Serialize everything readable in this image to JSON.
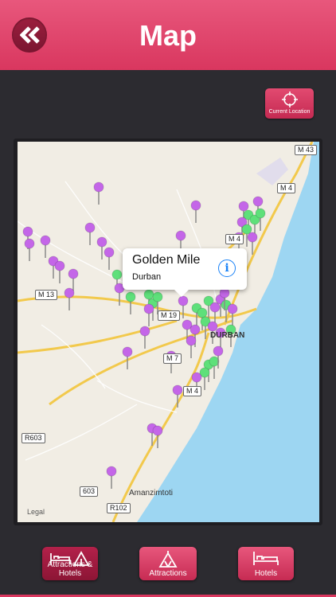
{
  "header": {
    "title": "Map"
  },
  "current_location_label": "Current Location",
  "callout": {
    "title": "Golden Mile",
    "subtitle": "Durban"
  },
  "map": {
    "legal": "Legal",
    "roads": [
      "M 43",
      "M 4",
      "M 4",
      "M 13",
      "M 19",
      "M 7",
      "M 4",
      "R603",
      "603",
      "R102"
    ],
    "places": [
      "Amanzimtoti",
      "DURBAN"
    ]
  },
  "tabs": [
    {
      "label": "Attractions & Hotels",
      "icon": "bed-and-tent-icon"
    },
    {
      "label": "Attractions",
      "icon": "tent-icon"
    },
    {
      "label": "Hotels",
      "icon": "bed-icon"
    }
  ],
  "colors": {
    "accent": "#e24a70",
    "pin_purple": "#c466e8",
    "pin_green": "#5ee07a",
    "sea": "#9dd6f2"
  }
}
